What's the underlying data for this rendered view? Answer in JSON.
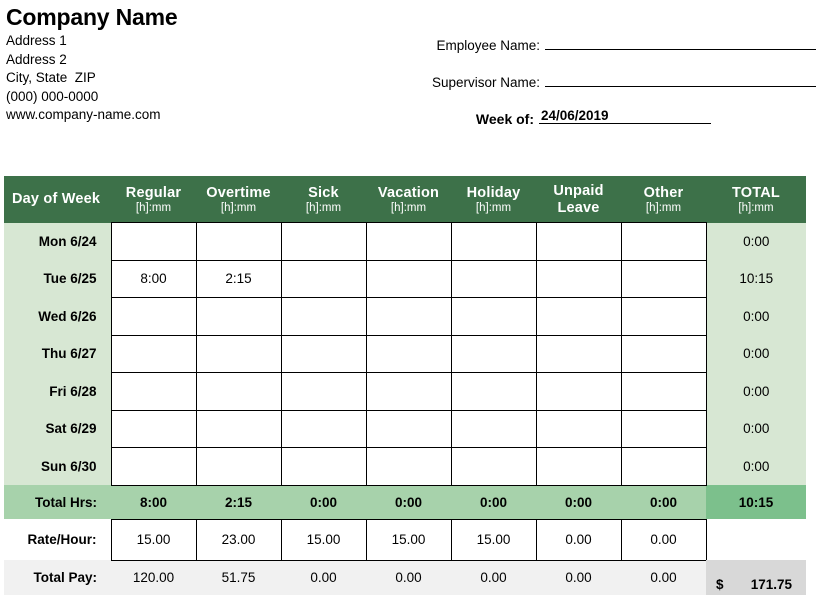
{
  "company": {
    "name": "Company Name",
    "address_1": "Address 1",
    "address_2": "Address 2",
    "city_state_zip": "City, State  ZIP",
    "phone": "(000) 000-0000",
    "website": "www.company-name.com"
  },
  "form": {
    "employee_label": "Employee Name:",
    "employee_value": "",
    "supervisor_label": "Supervisor Name:",
    "supervisor_value": "",
    "week_label": "Week of:",
    "week_value": "24/06/2019"
  },
  "table": {
    "day_header": "Day of Week",
    "unit": "[h]:mm",
    "columns": [
      {
        "label": "Regular",
        "unit": "[h]:mm"
      },
      {
        "label": "Overtime",
        "unit": "[h]:mm"
      },
      {
        "label": "Sick",
        "unit": "[h]:mm"
      },
      {
        "label": "Vacation",
        "unit": "[h]:mm"
      },
      {
        "label": "Holiday",
        "unit": "[h]:mm"
      },
      {
        "label": "Unpaid",
        "unit": "Leave"
      },
      {
        "label": "Other",
        "unit": "[h]:mm"
      },
      {
        "label": "TOTAL",
        "unit": "[h]:mm"
      }
    ],
    "rows": [
      {
        "day": "Mon 6/24",
        "values": [
          "",
          "",
          "",
          "",
          "",
          "",
          ""
        ],
        "total": "0:00"
      },
      {
        "day": "Tue 6/25",
        "values": [
          "8:00",
          "2:15",
          "",
          "",
          "",
          "",
          ""
        ],
        "total": "10:15"
      },
      {
        "day": "Wed 6/26",
        "values": [
          "",
          "",
          "",
          "",
          "",
          "",
          ""
        ],
        "total": "0:00"
      },
      {
        "day": "Thu 6/27",
        "values": [
          "",
          "",
          "",
          "",
          "",
          "",
          ""
        ],
        "total": "0:00"
      },
      {
        "day": "Fri 6/28",
        "values": [
          "",
          "",
          "",
          "",
          "",
          "",
          ""
        ],
        "total": "0:00"
      },
      {
        "day": "Sat 6/29",
        "values": [
          "",
          "",
          "",
          "",
          "",
          "",
          ""
        ],
        "total": "0:00"
      },
      {
        "day": "Sun 6/30",
        "values": [
          "",
          "",
          "",
          "",
          "",
          "",
          ""
        ],
        "total": "0:00"
      }
    ],
    "total_hours": {
      "label": "Total Hrs:",
      "values": [
        "8:00",
        "2:15",
        "0:00",
        "0:00",
        "0:00",
        "0:00",
        "0:00"
      ],
      "total": "10:15"
    },
    "rate_per_hour": {
      "label": "Rate/Hour:",
      "values": [
        "15.00",
        "23.00",
        "15.00",
        "15.00",
        "15.00",
        "0.00",
        "0.00"
      ]
    },
    "total_pay": {
      "label": "Total Pay:",
      "values": [
        "120.00",
        "51.75",
        "0.00",
        "0.00",
        "0.00",
        "0.00",
        "0.00"
      ],
      "currency": "$",
      "total": "171.75"
    }
  },
  "colors": {
    "header_green": "#3d7149",
    "row_green": "#d7e7d3",
    "total_green": "#a7d2ab",
    "grand_green": "#7cc08c",
    "pay_grey": "#f1f1f1",
    "grand_grey": "#d8d8d8"
  }
}
